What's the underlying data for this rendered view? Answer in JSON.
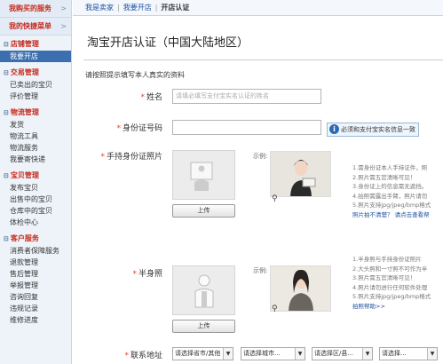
{
  "sidebar": {
    "top": [
      {
        "label": "我购买的服务",
        "chev": ">"
      },
      {
        "label": "我的快捷菜单",
        "chev": ">"
      }
    ],
    "groups": [
      {
        "title": "店铺管理",
        "items": [
          "我要开店"
        ]
      },
      {
        "title": "交易管理",
        "items": [
          "已卖出的宝贝",
          "评价管理"
        ]
      },
      {
        "title": "物流管理",
        "items": [
          "发货",
          "物流工具",
          "物流服务",
          "我要寄快递"
        ]
      },
      {
        "title": "宝贝管理",
        "items": [
          "发布宝贝",
          "出售中的宝贝",
          "仓库中的宝贝",
          "体检中心"
        ]
      },
      {
        "title": "客户服务",
        "items": [
          "消费者保障服务",
          "退款管理",
          "售后管理",
          "举报管理",
          "咨询回复",
          "违规记录",
          "维修进度"
        ]
      }
    ]
  },
  "breadcrumb": {
    "a": "我是卖家",
    "b": "我要开店",
    "c": "开店认证",
    "sep": "|"
  },
  "page": {
    "title": "淘宝开店认证（中国大陆地区）",
    "hint": "请按照提示填写本人真实的资料"
  },
  "form": {
    "name_label": "姓名",
    "name_placeholder": "请填必填写支付宝实名认证的姓名",
    "id_label": "身份证号码",
    "tip": "必须和支付宝实名信息一致",
    "photo1_label": "手持身份证照片",
    "photo2_label": "半身照",
    "upload": "上传",
    "example": "示例:",
    "rules1": [
      "1.需身份证本人手持证件，照",
      "2.照片需五官清晰可见！",
      "3.身份证上的信息需无遮挡。",
      "4.拍照需露出手臂，照片请勿",
      "5.照片支持jpg/jpeg/bmp格式"
    ],
    "link1": "照片拍不清楚？ 请点击查看帮",
    "rules2": [
      "1.半身照与手持身份证照片",
      "2.大头照和一寸照不可作为半",
      "3.照片需五官清晰可见！",
      "4.照片请勿进行任何软件处理",
      "5.照片支持jpg/jpeg/bmp格式"
    ],
    "link2": "拍照帮助>>",
    "addr_label": "联系地址",
    "addr": [
      "请选择省市/其他",
      "请选择城市...",
      "请选择区/县...",
      "请选择..."
    ]
  },
  "colors": {
    "accent": "#c6291b",
    "link": "#1c4fa0",
    "selected": "#3b6fb0"
  }
}
